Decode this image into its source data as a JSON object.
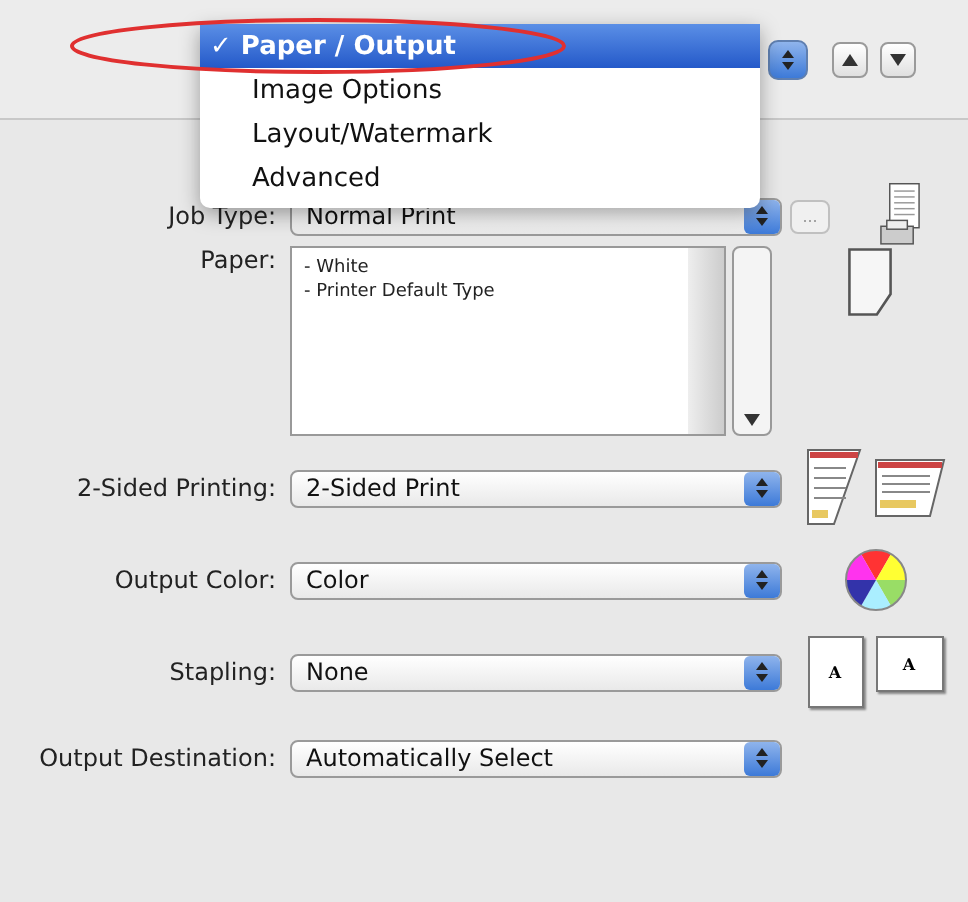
{
  "popup_menu": {
    "check": "✓",
    "items": [
      {
        "label": "Paper / Output",
        "selected": true
      },
      {
        "label": "Image Options",
        "selected": false
      },
      {
        "label": "Layout/Watermark",
        "selected": false
      },
      {
        "label": "Advanced",
        "selected": false
      }
    ]
  },
  "rows": [
    {
      "kind": "select",
      "label": "Job Type:",
      "value": "Normal Print",
      "more_button": "..."
    },
    {
      "kind": "list",
      "label": "Paper:",
      "items": [
        "- White",
        "- Printer Default Type"
      ]
    },
    {
      "kind": "select",
      "label": "2-Sided Printing:",
      "value": "2-Sided Print"
    },
    {
      "kind": "select",
      "label": "Output Color:",
      "value": "Color"
    },
    {
      "kind": "select",
      "label": "Stapling:",
      "value": "None",
      "preview_letters": [
        "A",
        "A"
      ]
    },
    {
      "kind": "select",
      "label": "Output Destination:",
      "value": "Automatically Select"
    }
  ]
}
